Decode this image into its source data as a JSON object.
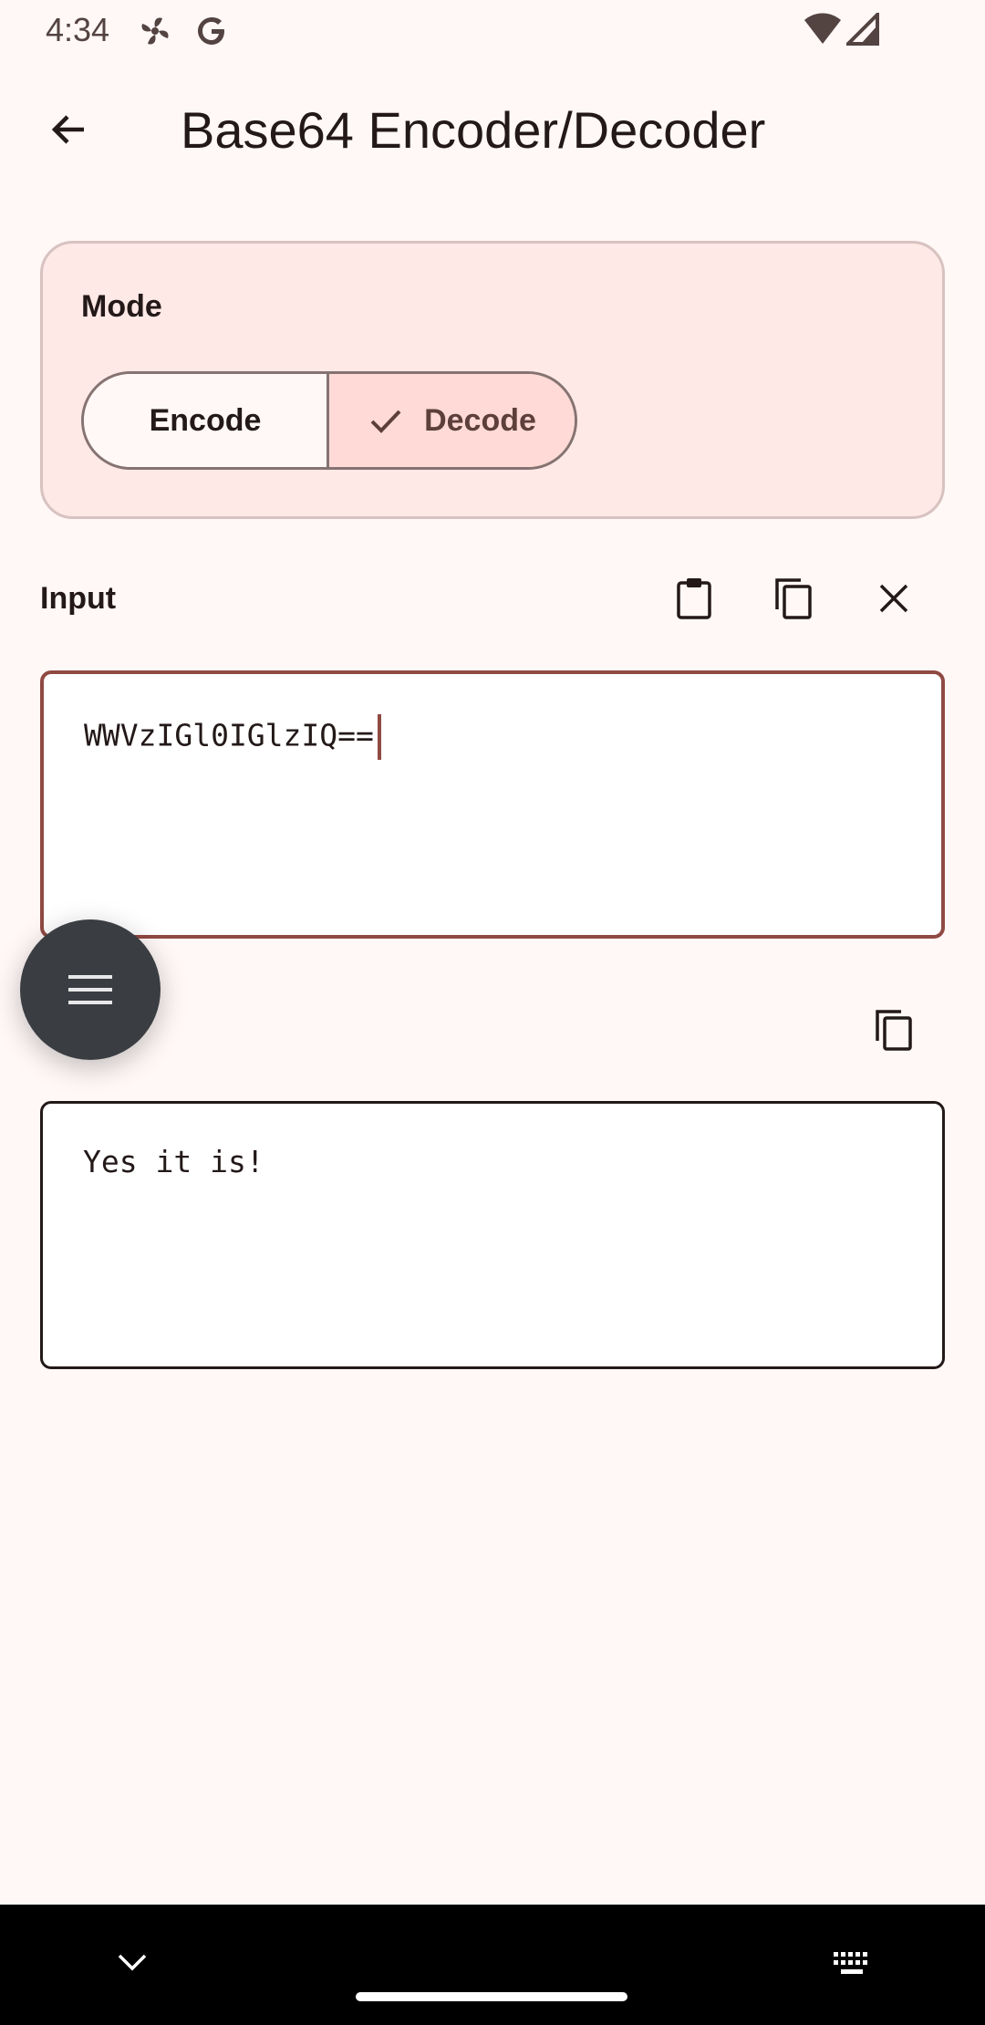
{
  "status_bar": {
    "time": "4:34",
    "icons": [
      "fan-icon",
      "google-icon",
      "wifi-icon",
      "signal-icon"
    ]
  },
  "app_bar": {
    "title": "Base64 Encoder/Decoder",
    "back_icon": "arrow-back-icon"
  },
  "mode": {
    "label": "Mode",
    "options": [
      "Encode",
      "Decode"
    ],
    "selected": "Decode"
  },
  "input": {
    "label": "Input",
    "value": "WWVzIGl0IGlzIQ==",
    "actions": [
      "paste-icon",
      "copy-icon",
      "close-icon"
    ]
  },
  "output": {
    "value": "Yes it is!",
    "actions": [
      "copy-icon"
    ]
  },
  "fab": {
    "icon": "menu-icon"
  },
  "colors": {
    "background": "#fff8f7",
    "primary": "#904a43",
    "selected_segment": "#ffdad6",
    "card": "#ffe9e6",
    "fab": "#3a3d42"
  }
}
